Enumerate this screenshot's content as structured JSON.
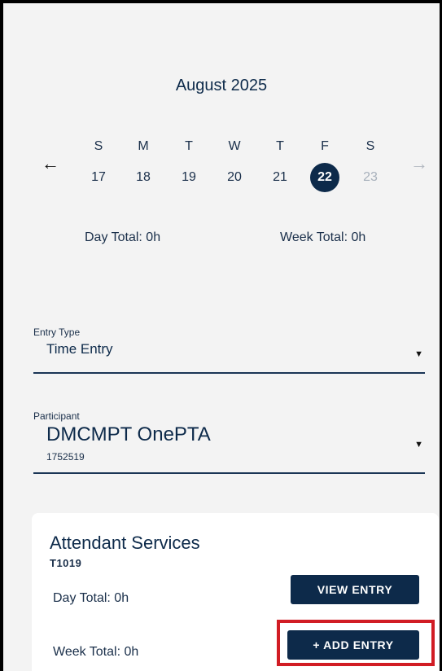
{
  "calendar": {
    "month_title": "August 2025",
    "prev_icon": "arrow-left-icon",
    "next_icon": "arrow-right-icon",
    "days": [
      {
        "dow": "S",
        "date": "17",
        "state": "normal"
      },
      {
        "dow": "M",
        "date": "18",
        "state": "normal"
      },
      {
        "dow": "T",
        "date": "19",
        "state": "normal"
      },
      {
        "dow": "W",
        "date": "20",
        "state": "normal"
      },
      {
        "dow": "T",
        "date": "21",
        "state": "normal"
      },
      {
        "dow": "F",
        "date": "22",
        "state": "selected"
      },
      {
        "dow": "S",
        "date": "23",
        "state": "disabled"
      }
    ],
    "day_total": "Day Total: 0h",
    "week_total": "Week Total: 0h"
  },
  "entry_type": {
    "label": "Entry Type",
    "value": "Time Entry",
    "caret_icon": "caret-down-icon"
  },
  "participant": {
    "label": "Participant",
    "value": "DMCMPT OnePTA",
    "id": "1752519",
    "caret_icon": "caret-down-icon"
  },
  "service_card": {
    "name": "Attendant Services",
    "code": "T1019",
    "day_total": "Day Total: 0h",
    "week_total": "Week Total: 0h",
    "view_button": "VIEW ENTRY",
    "add_button": "+ ADD ENTRY"
  },
  "colors": {
    "primary": "#0d2a4a",
    "highlight": "#d11c24",
    "background": "#f3f3f3"
  }
}
